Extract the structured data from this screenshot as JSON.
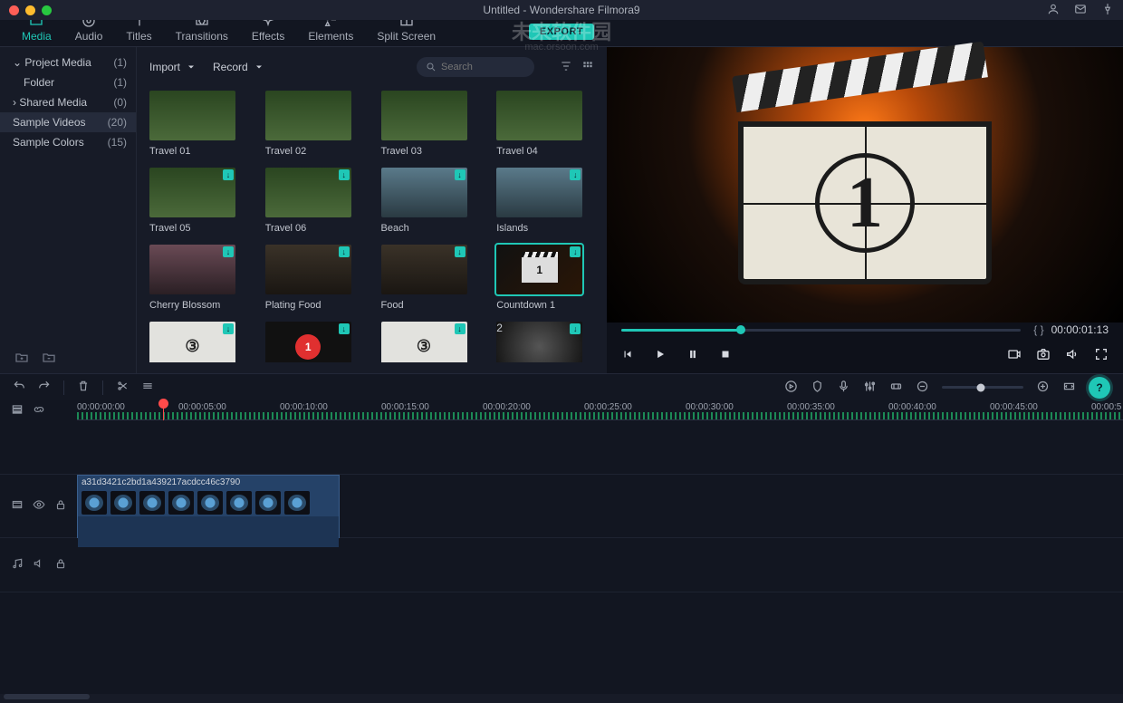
{
  "titlebar": {
    "title": "Untitled - Wondershare Filmora9"
  },
  "watermark": {
    "main": "未来软件园",
    "sub": "mac.orsoon.com"
  },
  "export_label": "EXPORT",
  "tabs": [
    {
      "label": "Media",
      "active": true
    },
    {
      "label": "Audio"
    },
    {
      "label": "Titles"
    },
    {
      "label": "Transitions"
    },
    {
      "label": "Effects"
    },
    {
      "label": "Elements"
    },
    {
      "label": "Split Screen"
    }
  ],
  "tree": [
    {
      "label": "Project Media",
      "count": "(1)",
      "chev": "down"
    },
    {
      "label": "Folder",
      "count": "(1)",
      "sub": true
    },
    {
      "label": "Shared Media",
      "count": "(0)",
      "chev": "right"
    },
    {
      "label": "Sample Videos",
      "count": "(20)",
      "sel": true
    },
    {
      "label": "Sample Colors",
      "count": "(15)"
    }
  ],
  "media_bar": {
    "import": "Import",
    "record": "Record",
    "search_placeholder": "Search"
  },
  "clips": [
    {
      "label": "Travel 01",
      "cls": "tb-bike"
    },
    {
      "label": "Travel 02",
      "cls": "tb-bike"
    },
    {
      "label": "Travel 03",
      "cls": "tb-bike"
    },
    {
      "label": "Travel 04",
      "cls": "tb-bike"
    },
    {
      "label": "Travel 05",
      "cls": "tb-bike",
      "dl": true
    },
    {
      "label": "Travel 06",
      "cls": "tb-bike",
      "dl": true
    },
    {
      "label": "Beach",
      "cls": "tb-beach",
      "dl": true
    },
    {
      "label": "Islands",
      "cls": "tb-beach",
      "dl": true
    },
    {
      "label": "Cherry Blossom",
      "cls": "tb-cherry",
      "dl": true
    },
    {
      "label": "Plating Food",
      "cls": "tb-food",
      "dl": true
    },
    {
      "label": "Food",
      "cls": "tb-food",
      "dl": true
    },
    {
      "label": "Countdown 1",
      "cls": "tb-cd",
      "dl": true,
      "sel": true,
      "inner": "1"
    },
    {
      "label": "",
      "cls": "tb-white",
      "dl": true,
      "inner": "③"
    },
    {
      "label": "",
      "cls": "tb-red",
      "dl": true,
      "inner": "1"
    },
    {
      "label": "",
      "cls": "tb-white",
      "dl": true,
      "inner": "③"
    },
    {
      "label": "",
      "cls": "tb-smoke",
      "dl": true,
      "inner": "2"
    }
  ],
  "preview": {
    "countdown_number": "1",
    "timecode": "00:00:01:13",
    "brace": "{  }"
  },
  "ruler": {
    "ticks": [
      "00:00:00:00",
      "00:00:05:00",
      "00:00:10:00",
      "00:00:15:00",
      "00:00:20:00",
      "00:00:25:00",
      "00:00:30:00",
      "00:00:35:00",
      "00:00:40:00",
      "00:00:45:00",
      "00:00:5"
    ]
  },
  "timeline_clip": {
    "label": "a31d3421c2bd1a439217acdcc46c3790"
  }
}
